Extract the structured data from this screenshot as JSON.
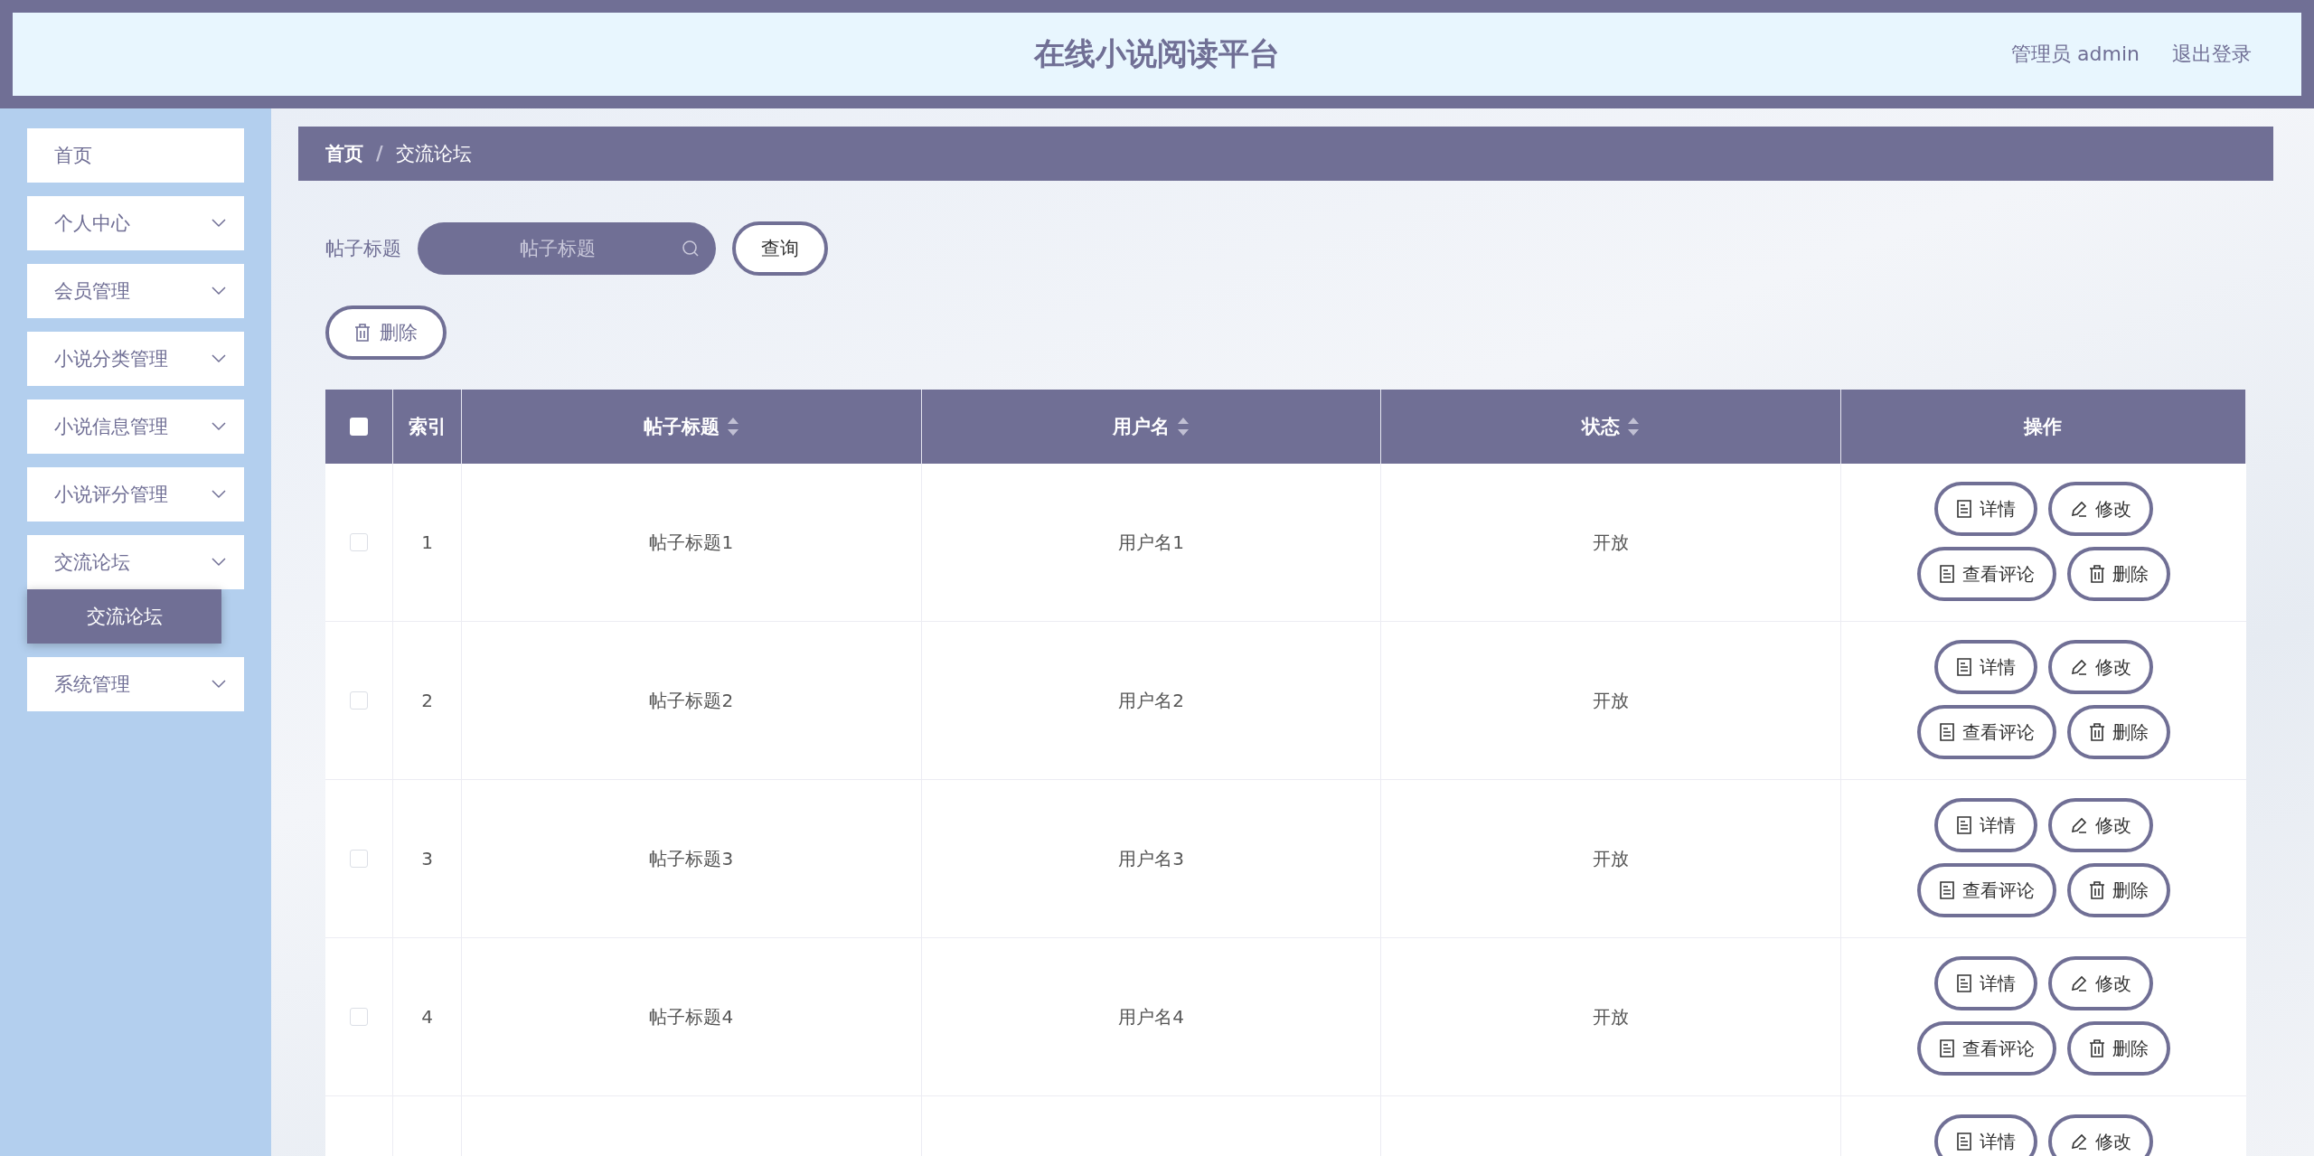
{
  "header": {
    "title": "在线小说阅读平台",
    "user": "管理员 admin",
    "logout": "退出登录"
  },
  "sidebar": {
    "items": [
      {
        "label": "首页",
        "has_children": false
      },
      {
        "label": "个人中心",
        "has_children": true,
        "expanded": false
      },
      {
        "label": "会员管理",
        "has_children": true,
        "expanded": false
      },
      {
        "label": "小说分类管理",
        "has_children": true,
        "expanded": false
      },
      {
        "label": "小说信息管理",
        "has_children": true,
        "expanded": false
      },
      {
        "label": "小说评分管理",
        "has_children": true,
        "expanded": false
      },
      {
        "label": "交流论坛",
        "has_children": true,
        "expanded": true,
        "children": [
          {
            "label": "交流论坛",
            "selected": true
          }
        ]
      },
      {
        "label": "系统管理",
        "has_children": true,
        "expanded": false
      }
    ]
  },
  "breadcrumb": {
    "separator": "/",
    "items": [
      "首页",
      "交流论坛"
    ]
  },
  "search": {
    "label": "帖子标题",
    "placeholder": "帖子标题",
    "button": "查询"
  },
  "toolbar": {
    "delete": "删除"
  },
  "table": {
    "header_checked": false,
    "columns": [
      {
        "label": "索引",
        "sortable": false
      },
      {
        "label": "帖子标题",
        "sortable": true
      },
      {
        "label": "用户名",
        "sortable": true
      },
      {
        "label": "状态",
        "sortable": true
      },
      {
        "label": "操作",
        "sortable": false
      }
    ],
    "rows": [
      {
        "checked": false,
        "index": "1",
        "title": "帖子标题1",
        "user": "用户名1",
        "status": "开放",
        "actions": [
          {
            "kind": "doc",
            "label": "详情"
          },
          {
            "kind": "edit",
            "label": "修改"
          },
          {
            "kind": "doc",
            "label": "查看评论"
          },
          {
            "kind": "trash",
            "label": "删除"
          }
        ]
      },
      {
        "checked": false,
        "index": "2",
        "title": "帖子标题2",
        "user": "用户名2",
        "status": "开放",
        "actions": [
          {
            "kind": "doc",
            "label": "详情"
          },
          {
            "kind": "edit",
            "label": "修改"
          },
          {
            "kind": "doc",
            "label": "查看评论"
          },
          {
            "kind": "trash",
            "label": "删除"
          }
        ]
      },
      {
        "checked": false,
        "index": "3",
        "title": "帖子标题3",
        "user": "用户名3",
        "status": "开放",
        "actions": [
          {
            "kind": "doc",
            "label": "详情"
          },
          {
            "kind": "edit",
            "label": "修改"
          },
          {
            "kind": "doc",
            "label": "查看评论"
          },
          {
            "kind": "trash",
            "label": "删除"
          }
        ]
      },
      {
        "checked": false,
        "index": "4",
        "title": "帖子标题4",
        "user": "用户名4",
        "status": "开放",
        "actions": [
          {
            "kind": "doc",
            "label": "详情"
          },
          {
            "kind": "edit",
            "label": "修改"
          },
          {
            "kind": "doc",
            "label": "查看评论"
          },
          {
            "kind": "trash",
            "label": "删除"
          }
        ]
      },
      {
        "actions": [
          {
            "kind": "doc",
            "label": "详情"
          },
          {
            "kind": "edit",
            "label": "修改"
          }
        ]
      }
    ]
  }
}
